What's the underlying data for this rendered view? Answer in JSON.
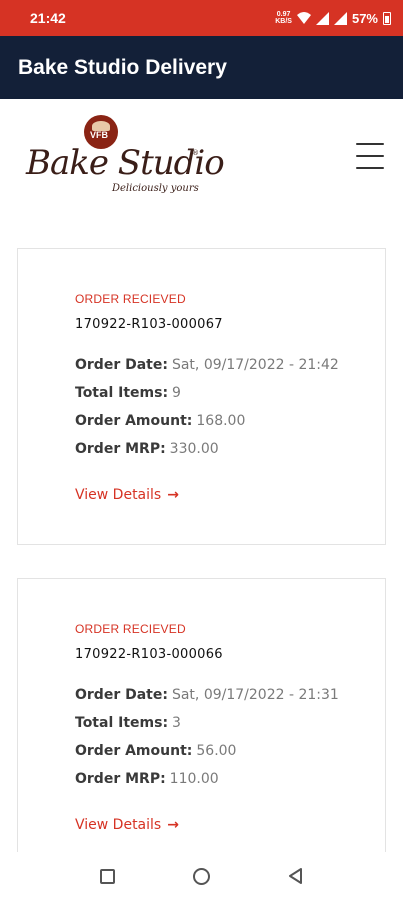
{
  "status_bar": {
    "time": "21:42",
    "net_speed_value": "0.97",
    "net_speed_unit": "KB/S",
    "battery": "57%"
  },
  "app_bar": {
    "title": "Bake Studio Delivery"
  },
  "header": {
    "logo": {
      "badge": "VFB",
      "name": "Bake Studio",
      "tagline": "Deliciously yours"
    },
    "menu_icon": "hamburger-menu-icon"
  },
  "orders": [
    {
      "status": "ORDER RECIEVED",
      "id": "170922-R103-000067",
      "date_label": "Order Date:",
      "date_value": "Sat, 09/17/2022 - 21:42",
      "items_label": "Total Items:",
      "items_value": "9",
      "amount_label": "Order Amount:",
      "amount_value": "168.00",
      "mrp_label": "Order MRP:",
      "mrp_value": "330.00",
      "view_label": "View Details"
    },
    {
      "status": "ORDER RECIEVED",
      "id": "170922-R103-000066",
      "date_label": "Order Date:",
      "date_value": "Sat, 09/17/2022 - 21:31",
      "items_label": "Total Items:",
      "items_value": "3",
      "amount_label": "Order Amount:",
      "amount_value": "56.00",
      "mrp_label": "Order MRP:",
      "mrp_value": "110.00",
      "view_label": "View Details"
    }
  ],
  "colors": {
    "status_bar": "#d63324",
    "app_bar": "#132038",
    "accent": "#d63324"
  },
  "nav_bar": {
    "recents_icon": "square-recents-icon",
    "home_icon": "circle-home-icon",
    "back_icon": "triangle-back-icon"
  }
}
